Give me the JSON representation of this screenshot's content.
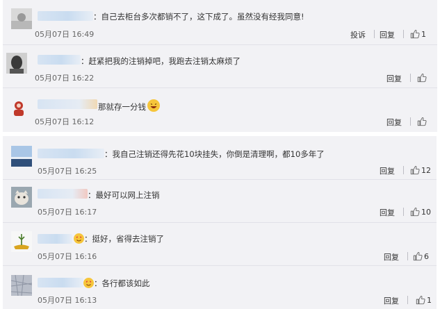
{
  "colors": {
    "panel_bg": "#f2f2f5",
    "divider": "#e1e1e8",
    "name_blur": "#d7e4f3"
  },
  "icons": {
    "like": "thumbs-up-icon",
    "laugh": "laughing-emoji-icon",
    "smile": "smiling-emoji-icon",
    "heart": "heart-emoji-icon"
  },
  "group_a": [
    {
      "text": "：自己去柜台多次都销不了，这下成了。虽然没有经我同意!",
      "time": "05月07日 16:49",
      "report": "投诉",
      "reply": "回复",
      "likes": "1"
    },
    {
      "text": "：赶紧把我的注销掉吧，我跑去注销太麻烦了",
      "time": "05月07日 16:22",
      "reply": "回复",
      "likes": ""
    },
    {
      "text": "那就存一分钱",
      "time": "05月07日 16:12",
      "reply": "回复",
      "likes": ""
    }
  ],
  "group_b": [
    {
      "text": "：我自己注销还得先花10块挂失，你倒是清理啊，都10多年了",
      "time": "05月07日 16:25",
      "reply": "回复",
      "likes": "12"
    },
    {
      "text": "：最好可以网上注销",
      "time": "05月07日 16:17",
      "reply": "回复",
      "likes": "10"
    },
    {
      "text": "：挺好，省得去注销了",
      "time": "05月07日 16:16",
      "reply": "回复",
      "likes": "6"
    },
    {
      "text": "：各行都该如此",
      "time": "05月07日 16:13",
      "reply": "回复",
      "likes": "1"
    }
  ]
}
